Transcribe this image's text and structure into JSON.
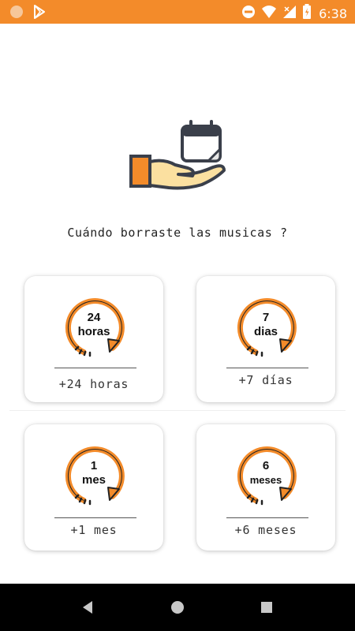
{
  "status_bar": {
    "time": "6:38",
    "bg_color": "#f38b2a",
    "left_icons": [
      "circle-icon",
      "play-store-icon"
    ],
    "right_icons": [
      "dnd-icon",
      "wifi-icon",
      "signal-icon",
      "battery-icon"
    ]
  },
  "hero": {
    "icon": "hand-calendar-icon"
  },
  "question": "Cuándo borraste las musicas ?",
  "options": [
    {
      "clock_top": "24",
      "clock_bottom": "horas",
      "label": "+24 horas"
    },
    {
      "clock_top": "7",
      "clock_bottom": "dias",
      "label": "+7 días"
    },
    {
      "clock_top": "1",
      "clock_bottom": "mes",
      "label": "+1 mes"
    },
    {
      "clock_top": "6",
      "clock_bottom": "meses",
      "label": "+6 meses"
    }
  ],
  "accent_color": "#f38b2a",
  "nav_bar": {
    "buttons": [
      "back-icon",
      "home-icon",
      "recents-icon"
    ]
  }
}
